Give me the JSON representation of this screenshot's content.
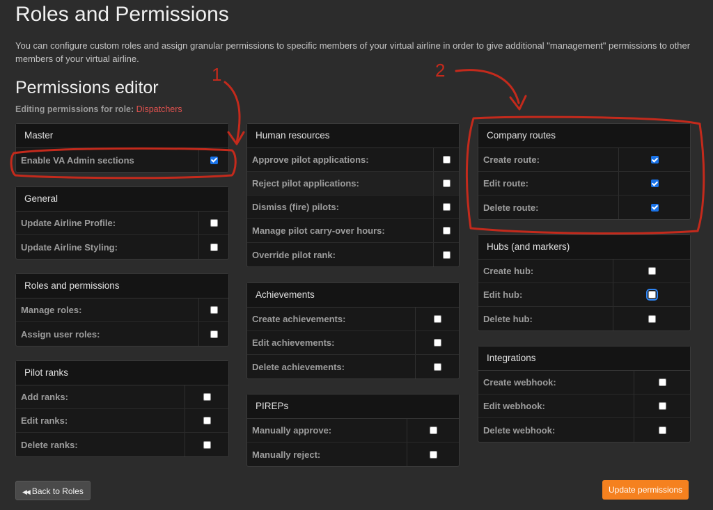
{
  "page": {
    "title": "Roles and Permissions",
    "intro": "You can configure custom roles and assign granular permissions to specific members of your virtual airline in order to give additional \"management\" permissions to other members of your virtual airline.",
    "editor_title": "Permissions editor",
    "editing_label": "Editing permissions for role:",
    "role_name": "Dispatchers"
  },
  "panels": {
    "master": {
      "title": "Master",
      "rows": [
        {
          "label": "Enable VA Admin sections",
          "checked": true
        }
      ]
    },
    "general": {
      "title": "General",
      "rows": [
        {
          "label": "Update Airline Profile:",
          "checked": false
        },
        {
          "label": "Update Airline Styling:",
          "checked": false
        }
      ]
    },
    "roles": {
      "title": "Roles and permissions",
      "rows": [
        {
          "label": "Manage roles:",
          "checked": false
        },
        {
          "label": "Assign user roles:",
          "checked": false
        }
      ]
    },
    "ranks": {
      "title": "Pilot ranks",
      "rows": [
        {
          "label": "Add ranks:",
          "checked": false
        },
        {
          "label": "Edit ranks:",
          "checked": false
        },
        {
          "label": "Delete ranks:",
          "checked": false
        }
      ]
    },
    "hr": {
      "title": "Human resources",
      "rows": [
        {
          "label": "Approve pilot applications:",
          "checked": false
        },
        {
          "label": "Reject pilot applications:",
          "checked": false
        },
        {
          "label": "Dismiss (fire) pilots:",
          "checked": false
        },
        {
          "label": "Manage pilot carry-over hours:",
          "checked": false
        },
        {
          "label": "Override pilot rank:",
          "checked": false
        }
      ]
    },
    "achievements": {
      "title": "Achievements",
      "rows": [
        {
          "label": "Create achievements:",
          "checked": false
        },
        {
          "label": "Edit achievements:",
          "checked": false
        },
        {
          "label": "Delete achievements:",
          "checked": false
        }
      ]
    },
    "pireps": {
      "title": "PIREPs",
      "rows": [
        {
          "label": "Manually approve:",
          "checked": false
        },
        {
          "label": "Manually reject:",
          "checked": false
        }
      ]
    },
    "routes": {
      "title": "Company routes",
      "rows": [
        {
          "label": "Create route:",
          "checked": true
        },
        {
          "label": "Edit route:",
          "checked": true
        },
        {
          "label": "Delete route:",
          "checked": true
        }
      ]
    },
    "hubs": {
      "title": "Hubs (and markers)",
      "rows": [
        {
          "label": "Create hub:",
          "checked": false
        },
        {
          "label": "Edit hub:",
          "checked": false
        },
        {
          "label": "Delete hub:",
          "checked": false
        }
      ]
    },
    "integrations": {
      "title": "Integrations",
      "rows": [
        {
          "label": "Create webhook:",
          "checked": false
        },
        {
          "label": "Edit webhook:",
          "checked": false
        },
        {
          "label": "Delete webhook:",
          "checked": false
        }
      ]
    }
  },
  "buttons": {
    "back": {
      "icon": "double-chevron-left-icon",
      "glyph": "◀◀",
      "label": "Back to Roles"
    },
    "update": {
      "label": "Update permissions"
    }
  },
  "annotations": {
    "arrow1": "1",
    "arrow2": "2"
  },
  "colors": {
    "accent_orange": "#f5811f",
    "role_red": "#e0524f",
    "annotation_red": "#c42a1c",
    "checkbox_blue": "#1a73e8"
  }
}
